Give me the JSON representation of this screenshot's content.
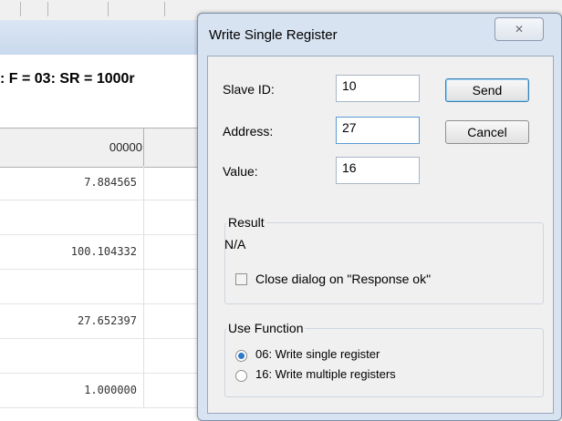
{
  "background": {
    "status_line": ": F = 03: SR = 1000r",
    "column_header": "00000",
    "rows": [
      "7.884565",
      "",
      "100.104332",
      "",
      "27.652397",
      "",
      "1.000000"
    ]
  },
  "dialog": {
    "title": "Write Single Register",
    "close_glyph": "✕",
    "fields": {
      "slave_id": {
        "label": "Slave ID:",
        "value": "10"
      },
      "address": {
        "label": "Address:",
        "value": "27"
      },
      "value": {
        "label": "Value:",
        "value": "16"
      }
    },
    "buttons": {
      "send": "Send",
      "cancel": "Cancel"
    },
    "result": {
      "title": "Result",
      "text": "N/A",
      "close_dialog_label": "Close dialog on \"Response ok\"",
      "close_dialog_checked": false
    },
    "use_function": {
      "title": "Use Function",
      "options": [
        {
          "label": "06: Write single register",
          "selected": true
        },
        {
          "label": "16: Write multiple registers",
          "selected": false
        }
      ]
    }
  }
}
